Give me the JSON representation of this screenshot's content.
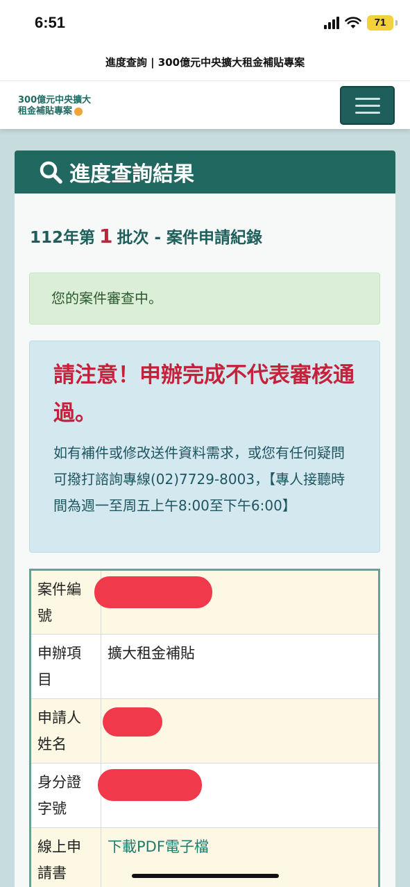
{
  "status_bar": {
    "time": "6:51",
    "battery": "71"
  },
  "browser": {
    "page_title": "進度查詢 | 300億元中央擴大租金補貼專案"
  },
  "header": {
    "logo_line1": "300億元中央擴大",
    "logo_line2": "租金補貼專案"
  },
  "card": {
    "title": "進度查詢結果",
    "batch": {
      "prefix": "112年第",
      "number": "1",
      "suffix": "批次 - 案件申請紀錄"
    },
    "status_message": "您的案件審查中。",
    "notice": {
      "warning": "請注意！申辦完成不代表審核通過。",
      "line1": "如有補件或修改送件資料需求，或您有任何疑問",
      "line2": "可撥打諮詢專線(02)7729-8003，【專人接聽時間為週一至周五上午8:00至下午6:00】"
    },
    "table": {
      "rows": [
        {
          "label": "案件編號",
          "value": ""
        },
        {
          "label": "申辦項目",
          "value": "擴大租金補貼"
        },
        {
          "label": "申請人姓名",
          "value": ""
        },
        {
          "label": "身分證字號",
          "value": ""
        },
        {
          "label": "線上申請書",
          "value": "下載PDF電子檔"
        }
      ]
    }
  },
  "colors": {
    "primary": "#216960",
    "alert_red": "#c4213a",
    "redaction": "#f03a4c"
  }
}
